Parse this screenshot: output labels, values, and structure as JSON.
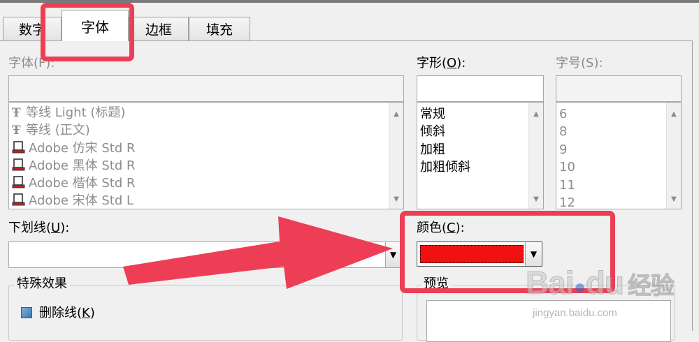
{
  "tabs": [
    {
      "label": "数字"
    },
    {
      "label": "字体"
    },
    {
      "label": "边框"
    },
    {
      "label": "填充"
    }
  ],
  "font": {
    "label": "字体(F):",
    "items": [
      {
        "icon": "truetype-icon",
        "text": "等线 Light (标题)"
      },
      {
        "icon": "truetype-icon",
        "text": "等线 (正文)"
      },
      {
        "icon": "printer-font-icon",
        "text": "Adobe 仿宋 Std R"
      },
      {
        "icon": "printer-font-icon",
        "text": "Adobe 黑体 Std R"
      },
      {
        "icon": "printer-font-icon",
        "text": "Adobe 楷体 Std R"
      },
      {
        "icon": "printer-font-icon",
        "text": "Adobe 宋体 Std L"
      }
    ]
  },
  "style": {
    "label_prefix": "字形(",
    "label_key": "O",
    "label_suffix": "):",
    "items": [
      "常规",
      "倾斜",
      "加粗",
      "加粗倾斜"
    ]
  },
  "size": {
    "label": "字号(S):",
    "items": [
      "6",
      "8",
      "9",
      "10",
      "11",
      "12"
    ]
  },
  "underline": {
    "label_prefix": "下划线(",
    "label_key": "U",
    "label_suffix": "):"
  },
  "color": {
    "label_prefix": "颜色(",
    "label_key": "C",
    "label_suffix": "):",
    "swatch_color": "#f01111"
  },
  "effects": {
    "legend": "特殊效果",
    "strikethrough_prefix": "删除线(",
    "strikethrough_key": "K",
    "strikethrough_suffix": ")"
  },
  "preview": {
    "label": "预览"
  },
  "watermark": {
    "brand": "Bai",
    "brand2": "du",
    "cn": "经验",
    "url": "jingyan.baidu.com"
  },
  "colors": {
    "highlight": "#ee3e55",
    "arrow": "#ee3e55"
  }
}
